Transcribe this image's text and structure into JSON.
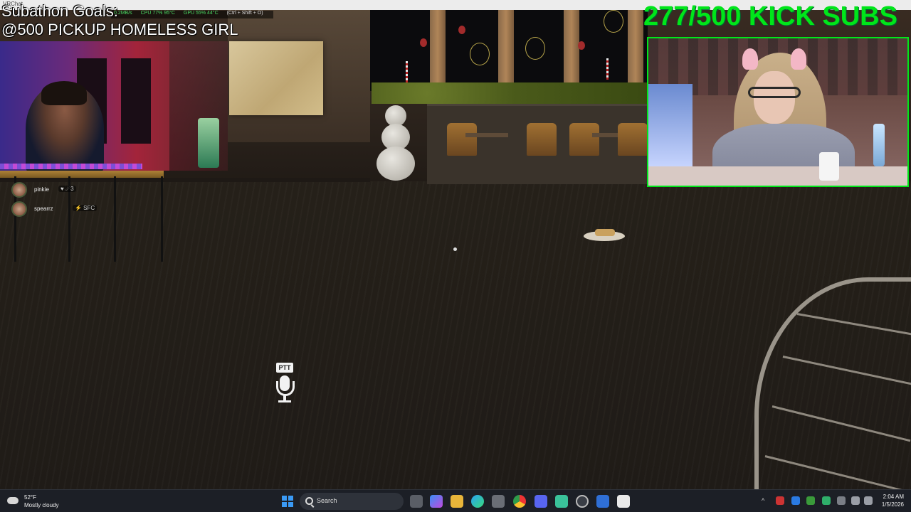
{
  "window": {
    "title": "VRChat"
  },
  "overlay": {
    "goals_title": "Subathon Goals:",
    "goals_item": "@500 PICKUP HOMELESS GIRL",
    "subs_counter": "277/500 KICK SUBS",
    "stats": {
      "net": "0.2MB/s",
      "cpu": "CPU  77%  95°C",
      "gpu": "GPU  55%  44°C",
      "hotkey": "(Ctrl + Shift + O)"
    },
    "ptt_label": "PTT"
  },
  "chat": [
    {
      "name": "pinkie",
      "badge": "♥ ☄3"
    },
    {
      "name": "spearrz",
      "badge": "⚡ SFC"
    }
  ],
  "taskbar": {
    "weather": {
      "temp": "52°F",
      "condition": "Mostly cloudy"
    },
    "search_label": "Search",
    "apps": [
      "file-explorer-icon",
      "copilot-icon",
      "folder-icon",
      "edge-icon",
      "store-icon",
      "chrome-icon",
      "discord-icon",
      "app-icon",
      "steam-icon",
      "app2-icon",
      "vrchat-icon"
    ],
    "clock": {
      "time": "2:04 AM",
      "date": "1/5/2026"
    }
  },
  "colors": {
    "accent_green": "#00e61a",
    "windows_blue": "#3a9af5"
  }
}
